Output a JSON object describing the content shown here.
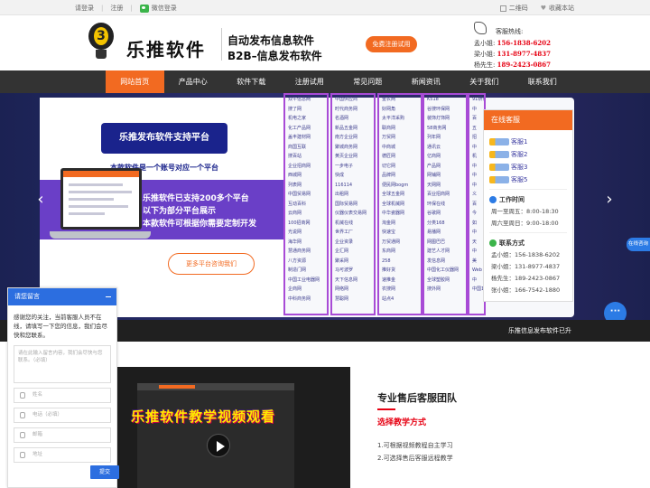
{
  "topbar": {
    "login": "请登录",
    "register": "注册",
    "wechat_login": "微信登录",
    "qrcode": "二维码",
    "favorite": "收藏本站"
  },
  "header": {
    "logo_text": "乐推软件",
    "slogan1": "自动发布信息软件",
    "slogan2": "B2B–信息发布软件",
    "trial_button": "免费注册试用",
    "hotline_title": "客服热线:",
    "contacts": [
      {
        "name": "孟小姐:",
        "phone": "156-1838-6202"
      },
      {
        "name": "梁小姐:",
        "phone": "131-8977-4837"
      },
      {
        "name": "杨先生:",
        "phone": "189-2423-0867"
      }
    ]
  },
  "nav": [
    "网站首页",
    "产品中心",
    "软件下载",
    "注册试用",
    "常见问题",
    "新闻资讯",
    "关于我们",
    "联系我们"
  ],
  "banner": {
    "title": "乐推发布软件支持平台",
    "subtitle": "本款软件是一个账号对应一个平台",
    "features": [
      "乐推软件已支持200多个平台",
      "以下为部分平台展示",
      "本款软件可根据你需要定制开发"
    ],
    "consult_button": "更多平台咨询我们",
    "platform_columns": [
      [
        "双午信息网",
        "搜了网",
        "机电之家",
        "化工产品网",
        "盖丰建材网",
        "商国互联",
        "搜百站",
        "企业招商网",
        "西城网",
        "列表网",
        "中国贸易网",
        "互动百科",
        "云商网",
        "100招商网",
        "光说网",
        "海华网",
        "慧通商务网",
        "八方资源",
        "制造门网",
        "中国工业电器网",
        "企商网",
        "中科商务网"
      ],
      [
        "中国供应商",
        "时代商务网",
        "名酒网",
        "新品五金网",
        "南方企业网",
        "聚城商务网",
        "黄页企业网",
        "一步电子",
        "快成",
        "116114",
        "出租网",
        "国际贸易网",
        "仪器仪表交易网",
        "机械在线",
        "世界工厂",
        "企业资录",
        "企汇网",
        "聚采网",
        "马可波罗",
        "天下信息网",
        "网络网",
        "慧聪网"
      ],
      [
        "金农网",
        "好网角",
        "太平洋采购",
        "联商网",
        "万贸网",
        "中商城",
        "德匠网",
        "切它网",
        "品牌网",
        "便民网bogm",
        "全球五金网",
        "全球机械网",
        "中华瓷器网",
        "淘金网",
        "快速宝",
        "万贸通网",
        "东商网",
        "258",
        "推好货",
        "速推金",
        "农搜网",
        "站点4"
      ],
      [
        "K518",
        "谷搜环保网",
        "装饰灯饰网",
        "58商务网",
        "列年网",
        "通讯云",
        "亿商网",
        "产品网",
        "网铺网",
        "天网网",
        "百业招商网",
        "环保在线",
        "谷歌网",
        "分类168",
        "易播网",
        "网图巴巴",
        "建艺人才网",
        "发信息网",
        "中国化工仪器网",
        "全球塑胶网",
        "搜外网",
        ""
      ],
      [
        "91研奢",
        "中",
        "百",
        "五",
        "招",
        "中",
        "机",
        "中",
        "中",
        "中",
        "义",
        "百",
        "今",
        "如",
        "中",
        "天",
        "中",
        "美",
        "Web",
        "中",
        "中国114",
        ""
      ]
    ]
  },
  "service": {
    "title": "在线客服",
    "qq": [
      "客服1",
      "客服2",
      "客服3",
      "客服5"
    ],
    "work_time_title": "工作时间",
    "work_times": [
      "周一至周五：8:00-18:30",
      "周六至周日：9:00-18:00"
    ],
    "contact_title": "联系方式",
    "contacts": [
      "孟小姐：156-1838-6202",
      "梁小姐：131-8977-4837",
      "杨先生：189-2423-0867",
      "张小姐：166-7542-1880"
    ]
  },
  "online_tag": "在线咨询",
  "ticker": "乐推信息发布软件已升",
  "video": {
    "title": "乐推软件教学视频观看"
  },
  "team": {
    "title": "专业售后客服团队",
    "subtitle": "选择教学方式",
    "items": [
      "1.可根据视频教程自主学习",
      "2.可选择售后客服远程教学"
    ]
  },
  "message": {
    "title": "请您留言",
    "intro": "感谢您的关注，当前客服人员不在线，请填写一下您的信息，我们会尽快和您联系。",
    "textarea_placeholder": "请在此输入留言内容，我们会尽快与您联系。（必填）",
    "fields": [
      "姓名",
      "电话（必填）",
      "邮箱",
      "地址"
    ],
    "submit": "提交"
  }
}
